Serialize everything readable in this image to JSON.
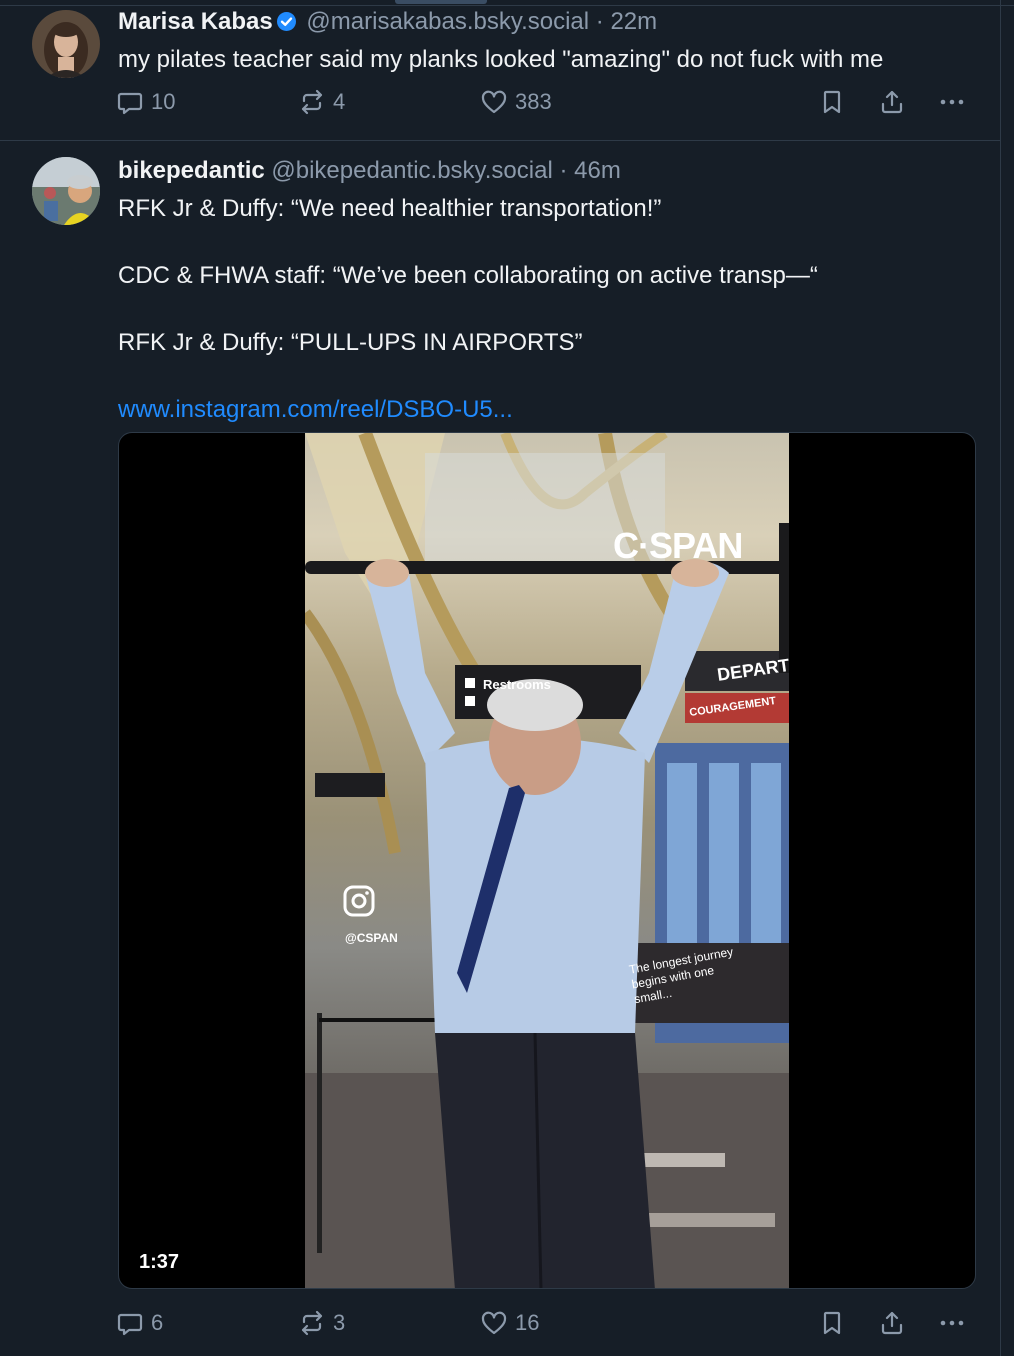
{
  "posts": [
    {
      "author_name": "Marisa Kabas",
      "handle": "@marisakabas.bsky.social",
      "separator": "·",
      "time": "22m",
      "verified": true,
      "text_lines": [
        "my pilates teacher said my planks looked \"amazing\" do not fuck with me"
      ],
      "replies": "10",
      "reposts": "4",
      "likes": "383"
    },
    {
      "author_name": "bikepedantic",
      "handle": "@bikepedantic.bsky.social",
      "separator": "·",
      "time": "46m",
      "verified": false,
      "text_lines": [
        "RFK Jr & Duffy: “We need healthier transportation!”",
        "CDC & FHWA staff: “We’ve been collaborating on active transp—“",
        "RFK Jr & Duffy: “PULL-UPS IN AIRPORTS”"
      ],
      "link": "www.instagram.com/reel/DSBO-U5...",
      "video": {
        "duration": "1:37",
        "watermark": "C·SPAN",
        "instagram_tag": "@CSPAN",
        "signs": {
          "restrooms": "Restrooms",
          "departures": "DEPARTU",
          "encouragement": "COURAGEMENT",
          "banner": "The longest journey begins with one small..."
        }
      },
      "replies": "6",
      "reposts": "3",
      "likes": "16"
    }
  ],
  "colors": {
    "background": "#161e27",
    "text": "#f1f3f5",
    "muted": "#8c9aab",
    "accent": "#208bfe",
    "border": "#2e3a47"
  },
  "icons": [
    "reply-icon",
    "repost-icon",
    "like-icon",
    "bookmark-icon",
    "share-icon",
    "more-icon",
    "verified-badge-icon",
    "instagram-icon"
  ]
}
